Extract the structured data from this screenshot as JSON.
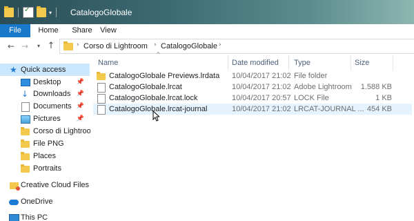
{
  "window": {
    "title": "CatalogoGlobale"
  },
  "ribbon": {
    "tabs": [
      "File",
      "Home",
      "Share",
      "View"
    ]
  },
  "address": {
    "crumbs": [
      "Corso di Lightroom",
      "CatalogoGlobale"
    ]
  },
  "sidebar": {
    "items": [
      {
        "label": "Quick access",
        "icon": "star-icon",
        "pinned": false
      },
      {
        "label": "Desktop",
        "icon": "desktop-icon",
        "pinned": true
      },
      {
        "label": "Downloads",
        "icon": "download-icon",
        "pinned": true
      },
      {
        "label": "Documents",
        "icon": "documents-icon",
        "pinned": true
      },
      {
        "label": "Pictures",
        "icon": "pictures-icon",
        "pinned": true
      },
      {
        "label": "Corso di Lightroom",
        "icon": "folder-icon",
        "pinned": false
      },
      {
        "label": "File PNG",
        "icon": "folder-icon",
        "pinned": false
      },
      {
        "label": "Places",
        "icon": "folder-icon",
        "pinned": false
      },
      {
        "label": "Portraits",
        "icon": "folder-icon",
        "pinned": false
      },
      {
        "label": "Creative Cloud Files",
        "icon": "creative-cloud-icon",
        "pinned": false
      },
      {
        "label": "OneDrive",
        "icon": "onedrive-icon",
        "pinned": false
      },
      {
        "label": "This PC",
        "icon": "computer-icon",
        "pinned": false
      }
    ]
  },
  "columns": {
    "name": "Name",
    "date": "Date modified",
    "type": "Type",
    "size": "Size"
  },
  "files": [
    {
      "name": "CatalogoGlobale Previews.lrdata",
      "date": "10/04/2017 21:02",
      "type": "File folder",
      "size": "",
      "icon": "folder-icon"
    },
    {
      "name": "CatalogoGlobale.lrcat",
      "date": "10/04/2017 21:02",
      "type": "Adobe Lightroom",
      "size": "1.588 KB",
      "icon": "file-icon"
    },
    {
      "name": "CatalogoGlobale.lrcat.lock",
      "date": "10/04/2017 20:57",
      "type": "LOCK File",
      "size": "1 KB",
      "icon": "file-icon"
    },
    {
      "name": "CatalogoGlobale.lrcat-journal",
      "date": "10/04/2017 21:02",
      "type": "LRCAT-JOURNAL ...",
      "size": "454 KB",
      "icon": "file-icon"
    }
  ],
  "colors": {
    "accent": "#1979ca",
    "selection": "#cce8ff",
    "hover": "#e5f3ff"
  }
}
